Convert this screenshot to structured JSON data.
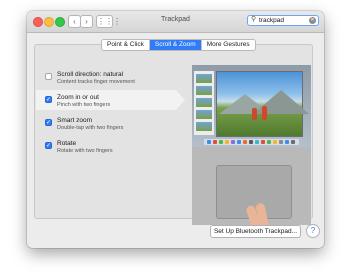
{
  "window": {
    "title": "Trackpad",
    "search_value": "trackpad",
    "search_icon": "magnifier",
    "clear_icon": "clear-x"
  },
  "tabs": [
    {
      "label": "Point & Click",
      "active": false
    },
    {
      "label": "Scroll & Zoom",
      "active": true
    },
    {
      "label": "More Gestures",
      "active": false
    }
  ],
  "options": [
    {
      "title": "Scroll direction: natural",
      "subtitle": "Content tracks finger movement",
      "checked": false
    },
    {
      "title": "Zoom in or out",
      "subtitle": "Pinch with two fingers",
      "checked": true
    },
    {
      "title": "Smart zoom",
      "subtitle": "Double-tap with two fingers",
      "checked": true
    },
    {
      "title": "Rotate",
      "subtitle": "Rotate with two fingers",
      "checked": true
    }
  ],
  "buttons": {
    "setup": "Set Up Bluetooth Trackpad...",
    "help": "?"
  },
  "colors": {
    "accent": "#2f7cf6",
    "close": "#fc605c",
    "minimize": "#fdbc40",
    "zoom": "#34c84a"
  }
}
